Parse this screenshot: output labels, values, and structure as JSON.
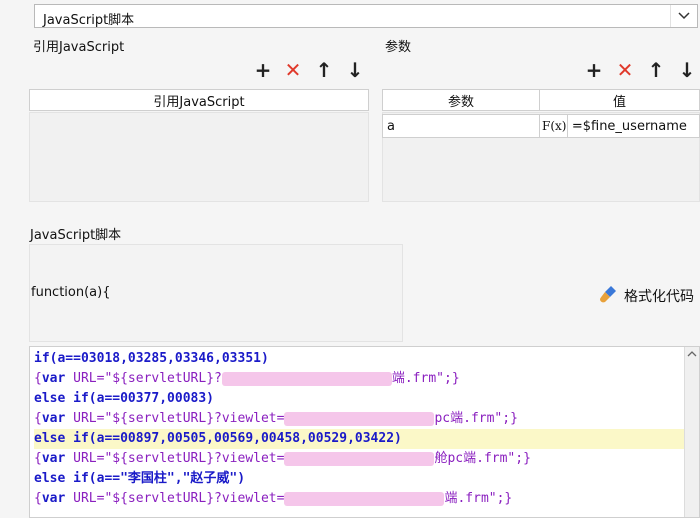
{
  "script_type_select": {
    "value": "JavaScript脚本"
  },
  "ref_js": {
    "label": "引用JavaScript",
    "column": "引用JavaScript"
  },
  "params": {
    "label": "参数",
    "columns": [
      "参数",
      "值"
    ],
    "rows": [
      {
        "name": "a",
        "formula_icon": "F(x)",
        "value": "=$fine_username"
      }
    ]
  },
  "toolbar": {
    "add": "+",
    "delete": "✕",
    "up": "↑",
    "down": "↓"
  },
  "js_script": {
    "label": "JavaScript脚本",
    "function_header": "function(a){",
    "format_label": "格式化代码"
  },
  "code": {
    "lines": [
      {
        "pre": "if(a==03018,03285,03346,03351)"
      },
      {
        "open": "{",
        "kw": "var",
        "mid": " URL=\"${servletURL}?",
        "tail": "端.frm\";}"
      },
      {
        "pre": "else if(a==00377,00083)"
      },
      {
        "open": "{",
        "kw": "var",
        "mid": " URL=\"${servletURL}?viewlet=",
        "tail": "pc端.frm\";}"
      },
      {
        "pre": "else if(a==00897,00505,00569,00458,00529,03422)"
      },
      {
        "open": "{",
        "kw": "var",
        "mid": " URL=\"${servletURL}?viewlet=",
        "tail": "舱pc端.frm\";}"
      },
      {
        "pre": "else if(a==\"李国柱\",\"赵子威\")"
      },
      {
        "open": "{",
        "kw": "var",
        "mid": " URL=\"${servletURL}?viewlet=",
        "tail": "端.frm\";}"
      }
    ]
  }
}
